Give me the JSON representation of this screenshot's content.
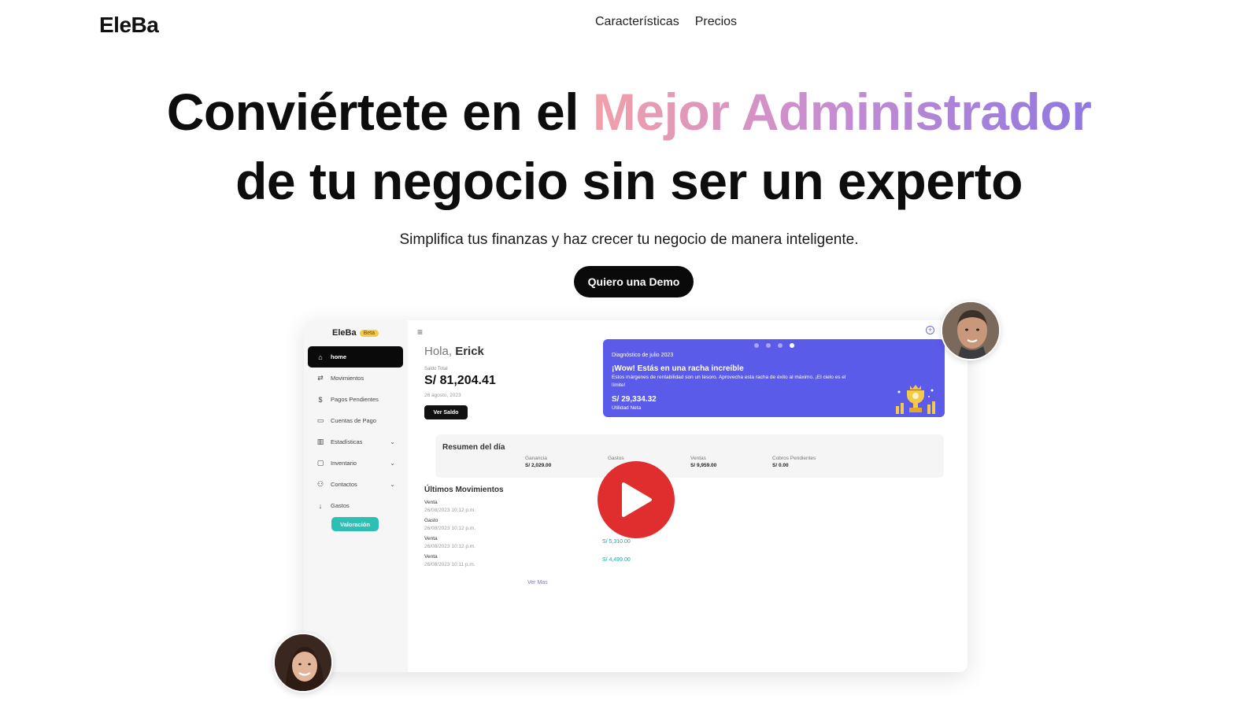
{
  "nav": {
    "logo": "EleBa",
    "links": [
      "Características",
      "Precios"
    ]
  },
  "hero": {
    "title_part1": "Conviértete en el ",
    "title_highlight": "Mejor Administrador",
    "title_part2": "de tu negocio sin ser un experto",
    "subtitle": "Simplifica tus finanzas y haz crecer tu negocio de manera inteligente.",
    "cta_label": "Quiero una Demo",
    "gradient": [
      "#f2a0a8",
      "#c98ed0",
      "#8f78e0"
    ]
  },
  "app": {
    "logo": "EleBa",
    "badge": "Beta",
    "sidebar": [
      {
        "label": "home",
        "icon": "home-icon",
        "active": true
      },
      {
        "label": "Movimientos",
        "icon": "arrows-icon"
      },
      {
        "label": "Pagos Pendientes",
        "icon": "dollar-clock-icon"
      },
      {
        "label": "Cuentas de Pago",
        "icon": "card-icon"
      },
      {
        "label": "Estadísticas",
        "icon": "bar-chart-icon",
        "expandable": true
      },
      {
        "label": "Inventario",
        "icon": "box-icon",
        "expandable": true
      },
      {
        "label": "Contactos",
        "icon": "users-icon",
        "expandable": true
      },
      {
        "label": "Gastos",
        "icon": "arrow-down-icon"
      }
    ],
    "valoracion": "Valoración",
    "greeting_prefix": "Hola, ",
    "greeting_name": "Erick",
    "saldo_label": "Saldo Total",
    "saldo_value": "S/ 81,204.41",
    "saldo_date": "26 agosto, 2023",
    "ver_saldo": "Ver Saldo",
    "diagnostico": {
      "title": "Diagnóstico de julio 2023",
      "heading": "¡Wow! Estás en una racha increíble",
      "text": "Estos márgenes de rentabilidad son un tesoro. Aprovecha esta racha de éxito al máximo. ¡El cielo es el límite!",
      "value": "S/ 29,334.32",
      "value_label": "Utilidad Neta",
      "color": "#5b5bea"
    },
    "resumen": {
      "title": "Resumen del día",
      "items": [
        {
          "label": "Ganancia",
          "value": "S/ 2,029.00"
        },
        {
          "label": "Gastos",
          "value": ""
        },
        {
          "label": "Ventas",
          "value": "S/ 9,959.00"
        },
        {
          "label": "Cobros Pendientes",
          "value": "S/ 0.00"
        }
      ]
    },
    "ultimos": {
      "title": "Últimos Movimientos",
      "items": [
        {
          "type": "Venta",
          "date": "26/08/2023 10:12 p.m.",
          "amount": ""
        },
        {
          "type": "Gasto",
          "date": "26/08/2023 10:12 p.m.",
          "amount": ""
        },
        {
          "type": "Venta",
          "date": "26/08/2023 10:12 p.m.",
          "amount": "S/ 5,310.00"
        },
        {
          "type": "Venta",
          "date": "26/08/2023 10:11 p.m.",
          "amount": "S/ 4,499.00"
        }
      ],
      "ver_mas": "Ver Mas"
    }
  }
}
